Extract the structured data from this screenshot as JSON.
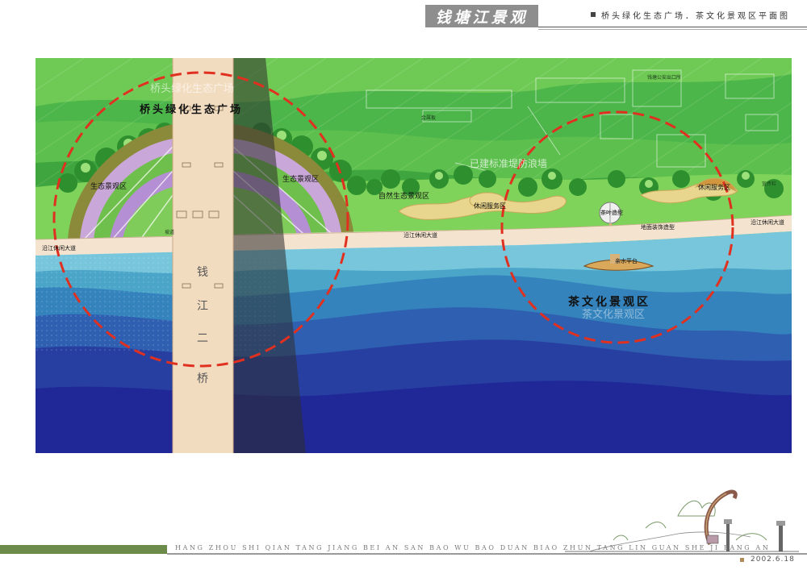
{
  "header": {
    "title": "钱塘江景观",
    "subtitle": "桥头绿化生态广场．茶文化景观区平面图"
  },
  "map": {
    "zones": {
      "bridgehead_plaza": "桥头绿化生态广场",
      "bridgehead_plaza_faint": "桥头绿化生态广场",
      "tea_culture": "茶文化景观区",
      "tea_culture_faint": "茶文化景观区"
    },
    "labels": {
      "eco_left": "生态景观区",
      "eco_right": "生态景观区",
      "natural_eco": "自然生态景观区",
      "rest_service": "休闲服务区",
      "rest_service_right": "休闲服务区",
      "embankment": "已建标准堤防浪墙",
      "tea_leaf": "茶叶造型",
      "ground_deco": "地面装饰造型",
      "water_platform": "亲水平台",
      "road_left": "沿江休闲大道",
      "road_mid": "沿江休闲大道",
      "road_right": "沿江休闲大道",
      "bridge_1": "钱",
      "bridge_2": "江",
      "bridge_3": "二",
      "bridge_4": "桥",
      "security_exit": "钱塘公安出口所",
      "small_building": "金属板",
      "sw_box": "宣传栏",
      "ramp": "坡道"
    },
    "colors": {
      "upper_green": "#4cb64a",
      "land_green": "#7fd35a",
      "river_light": "#78c6dc",
      "river_deep": "#20269a",
      "circle": "#e03020",
      "bridge": "#f2dcc0"
    }
  },
  "footer": {
    "pinyin": "HANG ZHOU SHI QIAN TANG JIANG BEI AN SAN BAO WU BAO DUAN BIAO ZHUN TANG LIN GUAN SHE JI FANG AN",
    "date": "2002.6.18"
  }
}
